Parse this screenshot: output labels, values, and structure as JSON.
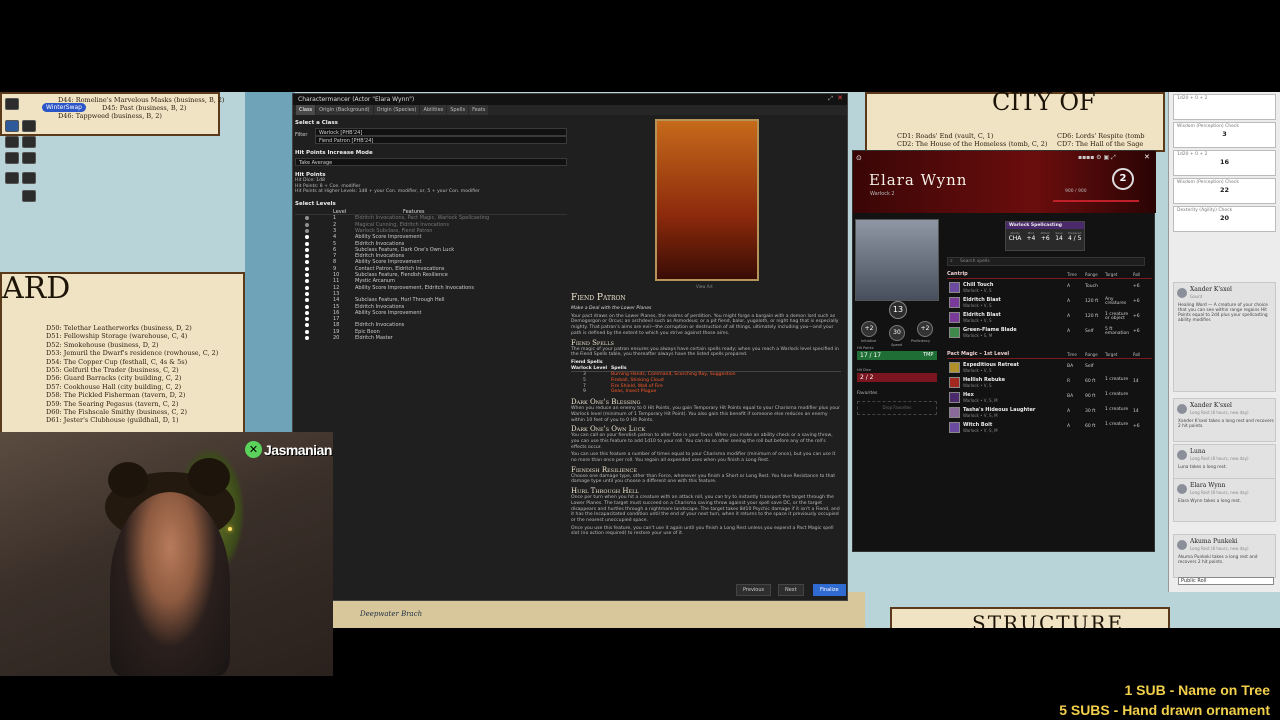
{
  "map": {
    "left_title": "ARD",
    "right_title": "CITY OF",
    "bottom_right_title": "STRUCTURE",
    "brach_label": "Deepwater Brach",
    "top_locations": [
      "D44: Romeline's Marvelous Masks (business, B, 2)",
      "D45: Past (business, B, 2)",
      "D46: Tappweed (business, B, 2)"
    ],
    "locations": [
      "D50: Telethar Leatherworks (business, D, 2)",
      "D51: Fellowship Storage (warehouse, C, 4)",
      "D52: Smokehouse (business, D, 2)",
      "D53: Jemuril the Dwarf's residence (rowhouse, C, 2)",
      "D54: The Copper Cup (festhall, C, 4s & 5s)",
      "D55: Gelfuril the Trader (business, C, 2)",
      "D56: Guard Barracks (city building, C, 2)",
      "D57: Cookhouse Hall (city building, C, 2)",
      "D58: The Pickled Fisherman (tavern, D, 2)",
      "D59: The Searing Pegasus (tavern, C, 2)",
      "D60: The Fishscale Smithy (business, C, 2)",
      "D61: Jester's Clubhouse (guildhall, D, 1)"
    ],
    "right_locations_a": [
      "CD1: Roads' End (vault, C, 1)",
      "CD2: The House of the Homeless (tomb, C, 2)"
    ],
    "right_locations_b": [
      "CD6: Lords' Respite (tomb",
      "CD7: The Hall of the Sage"
    ]
  },
  "top_chat": {
    "pill": "WinterSwap",
    "text": ""
  },
  "charactermancer": {
    "title": "Charactermancer (Actor \"Elara Wynn\")",
    "tabs": [
      "Class",
      "Origin (Background)",
      "Origin (Species)",
      "Abilities",
      "Spells",
      "Feats"
    ],
    "select_class_label": "Select a Class",
    "filter_label": "Filter",
    "class_value": "Warlock [PHB'24]",
    "subclass_value": "Fiend Patron [PHB'24]",
    "hp_mode_label": "Hit Points Increase Mode",
    "hp_mode_value": "Take Average",
    "hp_label": "Hit Points",
    "hp_lines": [
      "Hit Dice: 1d8",
      "Hit Points: 8 + Con. modifier",
      "Hit Points at Higher Levels: 1d8 + your Con. modifier, or, 5 + your Con. modifier"
    ],
    "select_levels_label": "Select Levels",
    "col_level": "Level",
    "col_features": "Features",
    "level_rows": [
      {
        "lv": "1",
        "ft": "Eldritch Invocations, Pact Magic, Warlock Spellcasting"
      },
      {
        "lv": "2",
        "ft": "Magical Cunning, Eldritch Invocations"
      },
      {
        "lv": "3",
        "ft": "Warlock Subclass, Fiend Patron"
      },
      {
        "lv": "4",
        "ft": "Ability Score Improvement"
      },
      {
        "lv": "5",
        "ft": "Eldritch Invocations"
      },
      {
        "lv": "6",
        "ft": "Subclass Feature, Dark One's Own Luck"
      },
      {
        "lv": "7",
        "ft": "Eldritch Invocations"
      },
      {
        "lv": "8",
        "ft": "Ability Score Improvement"
      },
      {
        "lv": "9",
        "ft": "Contact Patron, Eldritch Invocations"
      },
      {
        "lv": "10",
        "ft": "Subclass Feature, Fiendish Resilience"
      },
      {
        "lv": "11",
        "ft": "Mystic Arcanum"
      },
      {
        "lv": "12",
        "ft": "Ability Score Improvement, Eldritch Invocations"
      },
      {
        "lv": "13",
        "ft": ""
      },
      {
        "lv": "14",
        "ft": "Subclass Feature, Hurl Through Hell"
      },
      {
        "lv": "15",
        "ft": "Eldritch Invocations"
      },
      {
        "lv": "16",
        "ft": "Ability Score Improvement"
      },
      {
        "lv": "17",
        "ft": ""
      },
      {
        "lv": "18",
        "ft": "Eldritch Invocations"
      },
      {
        "lv": "19",
        "ft": "Epic Boon"
      },
      {
        "lv": "20",
        "ft": "Eldritch Master"
      }
    ],
    "art_caption": "View Art",
    "feature_title": "Fiend Patron",
    "feature_subtitle": "Make a Deal with the Lower Planes",
    "feature_intro": "Your pact draws on the Lower Planes, the realms of perdition. You might forge a bargain with a demon lord such as Demogorgon or Orcus; an archdevil such as Asmodeus; or a pit fiend, balor, yugoloth, or night hag that is especially mighty. That patron's aims are evil—the corruption or destruction of all things, ultimately including you—and your path is defined by the extent to which you strive against those aims.",
    "fiend_spells_title": "Fiend Spells",
    "fiend_spells_intro": "The magic of your patron ensures you always have certain spells ready; when you reach a Warlock level specified in the Fiend Spells table, you thereafter always have the listed spells prepared.",
    "spell_table_title": "Fiend Spells",
    "spell_table_cols": [
      "Warlock Level",
      "Spells"
    ],
    "spell_table_rows": [
      {
        "lv": "3",
        "sp": "Burning Hands, Command, Scorching Ray, Suggestion"
      },
      {
        "lv": "5",
        "sp": "Fireball, Stinking Cloud"
      },
      {
        "lv": "7",
        "sp": "Fire Shield, Wall of Fire"
      },
      {
        "lv": "9",
        "sp": "Geas, Insect Plague"
      }
    ],
    "blessing_title": "Dark One's Blessing",
    "blessing_text": "When you reduce an enemy to 0 Hit Points, you gain Temporary Hit Points equal to your Charisma modifier plus your Warlock level (minimum of 1 Temporary Hit Point). You also gain this benefit if someone else reduces an enemy within 10 feet of you to 0 Hit Points.",
    "luck_title": "Dark One's Own Luck",
    "luck_text": "You can call on your fiendish patron to alter fate in your favor. When you make an ability check or a saving throw, you can use this feature to add 1d10 to your roll. You can do so after seeing the roll but before any of the roll's effects occur.",
    "luck_text2": "You can use this feature a number of times equal to your Charisma modifier (minimum of once), but you can use it no more than once per roll. You regain all expended uses when you finish a Long Rest.",
    "resilience_title": "Fiendish Resilience",
    "resilience_text": "Choose one damage type, other than Force, whenever you finish a Short or Long Rest. You have Resistance to that damage type until you choose a different one with this feature.",
    "hurl_title": "Hurl Through Hell",
    "hurl_text": "Once per turn when you hit a creature with an attack roll, you can try to instantly transport the target through the Lower Planes. The target must succeed on a Charisma saving throw against your spell save DC, or the target disappears and hurtles through a nightmare landscape. The target takes 8d10 Psychic damage if it isn't a Fiend, and it has the Incapacitated condition until the end of your next turn, when it returns to the space it previously occupied or the nearest unoccupied space.",
    "hurl_text2": "Once you use this feature, you can't use it again until you finish a Long Rest unless you expend a Pact Magic spell slot (no action required) to restore your use of it.",
    "btn_previous": "Previous",
    "btn_next": "Next",
    "btn_finalize": "Finalize"
  },
  "sheet": {
    "name": "Elara Wynn",
    "class": "Warlock 2",
    "level": "2",
    "xp": "900 / 900",
    "ac": "13",
    "init": "+2",
    "speed": "30",
    "prof": "+2",
    "init_label": "Initiative",
    "speed_label": "Speed",
    "prof_label": "Proficiency",
    "hp_label": "Hit Points",
    "hp": "17",
    "hp_max": "17",
    "temp_label": "TMP",
    "hit_dice_label": "Hit Dice",
    "hit_dice": "2 / 2",
    "favorites_label": "Favorites",
    "drop_favorites": "Drop Favorites",
    "spellcasting_label": "Warlock Spellcasting",
    "sc_stats": [
      {
        "label": "Ability",
        "value": "CHA"
      },
      {
        "label": "Mod",
        "value": "+4"
      },
      {
        "label": "Attack",
        "value": "+6"
      },
      {
        "label": "Save",
        "value": "14"
      },
      {
        "label": "Prepared",
        "value": "4 / 5"
      }
    ],
    "search_placeholder": "Search spells",
    "cantrip_header": "Cantrip",
    "pact_header": "Pact Magic – 1st Level",
    "col_headers": [
      "Time",
      "Range",
      "Target",
      "Roll"
    ],
    "cantrips": [
      {
        "name": "Chill Touch",
        "sub": "Warlock • V, S",
        "time": "A",
        "range": "Touch",
        "target": "",
        "roll": "+6"
      },
      {
        "name": "Eldritch Blast",
        "sub": "Warlock • V, S",
        "time": "A",
        "range": "120 ft",
        "target": "Any creatures",
        "roll": "+6"
      },
      {
        "name": "Eldritch Blast",
        "sub": "Warlock • V, S",
        "time": "A",
        "range": "120 ft",
        "target": "1 creature or object",
        "roll": "+6"
      },
      {
        "name": "Green-Flame Blade",
        "sub": "Warlock • S, M",
        "time": "A",
        "range": "Self",
        "target": "5 ft emanation",
        "roll": "+6"
      }
    ],
    "pact_spells": [
      {
        "name": "Expeditious Retreat",
        "sub": "Warlock • V, S",
        "time": "BA",
        "range": "Self",
        "target": "",
        "roll": ""
      },
      {
        "name": "Hellish Rebuke",
        "sub": "Warlock • V, S",
        "time": "R",
        "range": "60 ft",
        "target": "1 creature",
        "roll": "14"
      },
      {
        "name": "Hex",
        "sub": "Warlock • V, S, M",
        "time": "BA",
        "range": "90 ft",
        "target": "1 creature",
        "roll": ""
      },
      {
        "name": "Tasha's Hideous Laughter",
        "sub": "Warlock • V, S, M",
        "time": "A",
        "range": "30 ft",
        "target": "1 creature",
        "roll": "14"
      },
      {
        "name": "Witch Bolt",
        "sub": "Warlock • V, S, M",
        "time": "A",
        "range": "60 ft",
        "target": "1 creature",
        "roll": "+6"
      }
    ]
  },
  "chat": {
    "rolls": [
      {
        "label": "1d20 + 0 + 2",
        "value": ""
      },
      {
        "label": "Wisdom (Perception) Check",
        "value": "3"
      },
      {
        "label": "1d20 + 0 + 2",
        "value": "16"
      },
      {
        "label": "Wisdom (Perception) Check",
        "value": "22"
      },
      {
        "label": "Dexterity (Agility) Check",
        "value": "20"
      }
    ],
    "messages": [
      {
        "who": "Xander K'sxel",
        "when": "Gaunt",
        "text": "Healing Word — A creature of your choice that you can see within range regains Hit Points equal to 2d4 plus your spellcasting ability modifier."
      },
      {
        "who": "Xander K'sxel",
        "when": "Long Rest (8 hours, new day)",
        "text": "Xander K'sxel takes a long rest and recovers 2 hit points."
      },
      {
        "who": "Luna",
        "when": "Long Rest (8 hours, new day)",
        "text": "Luna takes a long rest."
      },
      {
        "who": "Elara Wynn",
        "when": "Long Rest (8 hours, new day)",
        "text": "Elara Wynn takes a long rest."
      },
      {
        "who": "Akuma Punkeki",
        "when": "Long Rest (8 hours, new day)",
        "text": "Akuma Punkeki takes a long rest and recovers 2 hit points."
      }
    ],
    "roll_select": "Public Roll"
  },
  "stream": {
    "streamer_name": "Jasmanian",
    "sub_goals": [
      "1 SUB - Name on Tree",
      "5 SUBS - Hand drawn ornament"
    ]
  }
}
